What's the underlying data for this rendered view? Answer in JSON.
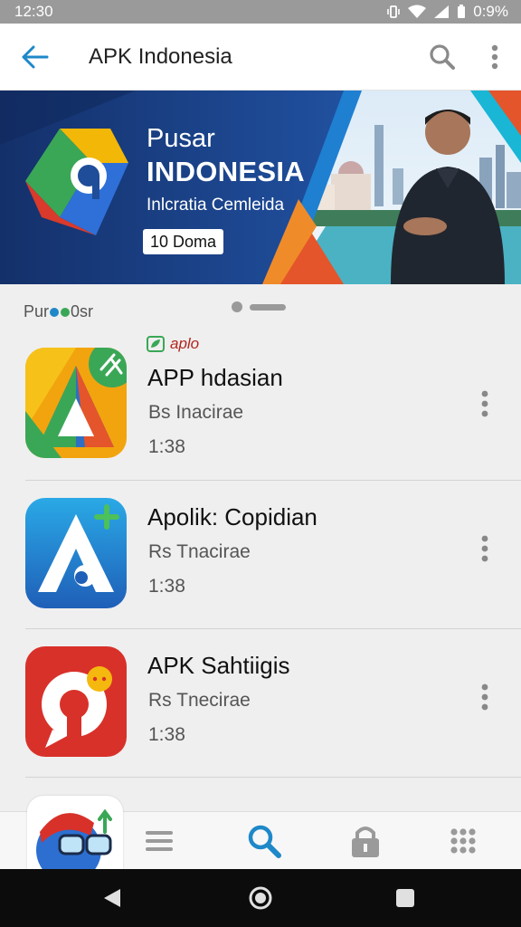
{
  "status_bar": {
    "time": "12:30",
    "battery": "0:9%"
  },
  "app_bar": {
    "title": "APK Indonesia"
  },
  "banner": {
    "title_line1": "Pusar",
    "title_line2": "INDONESIA",
    "subtitle": "Inlcratia Cemleida",
    "button_label": "10 Doma"
  },
  "section": {
    "label_prefix": "Pur",
    "label_suffix": "0sr"
  },
  "apps": [
    {
      "tag": "aplo",
      "title": "APP hdasian",
      "subtitle": "Bs Inacirae",
      "time": "1:38"
    },
    {
      "title": "Apolik: Copidian",
      "subtitle": "Rs Tnacirae",
      "time": "1:38"
    },
    {
      "title": "APK Sahtiigis",
      "subtitle": "Rs Tnecirae",
      "time": "1:38"
    }
  ],
  "colors": {
    "accent": "#1e88c8",
    "banner_bg": "#1b3a7a",
    "tag_red": "#b3261e"
  }
}
